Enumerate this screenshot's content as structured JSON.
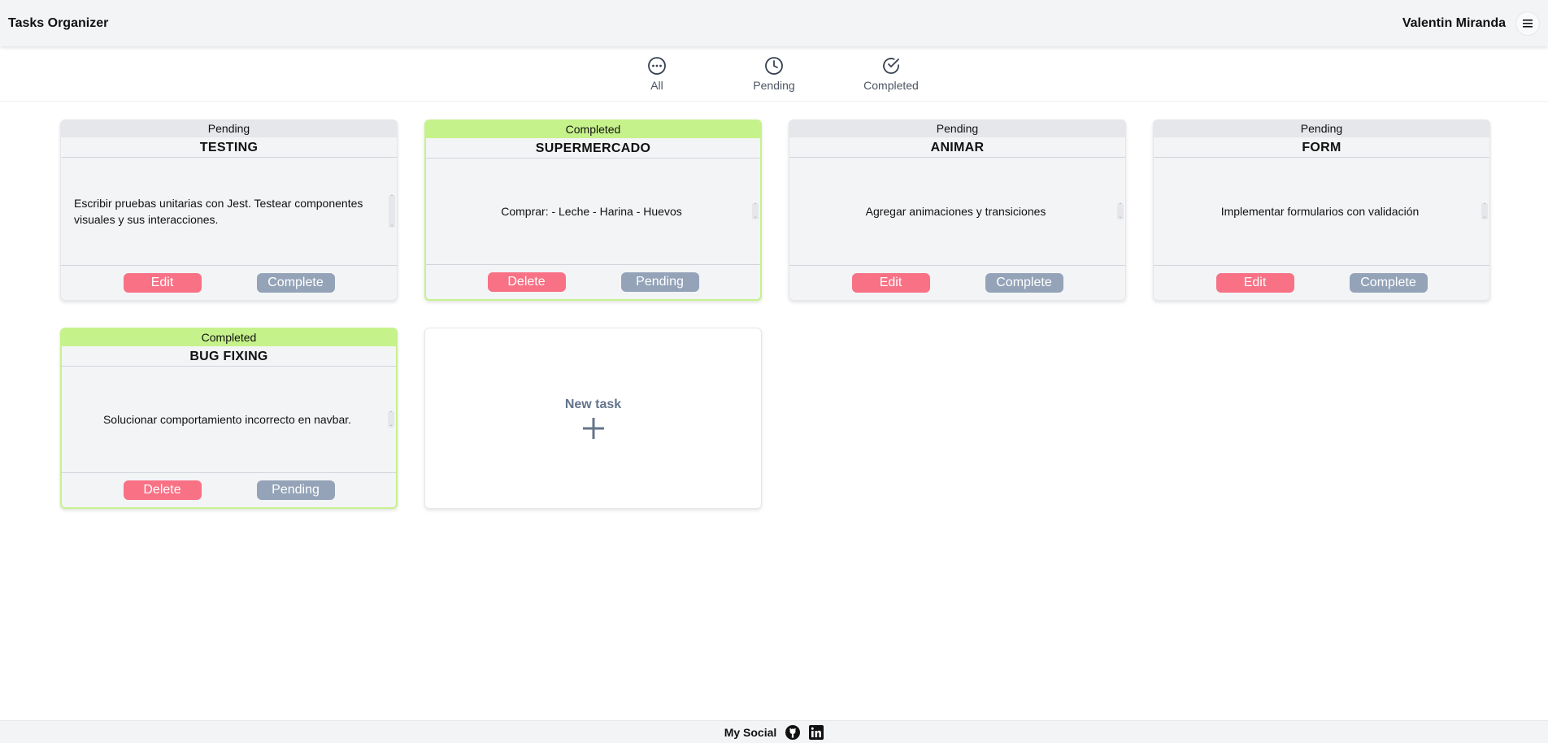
{
  "header": {
    "title": "Tasks Organizer",
    "user_name": "Valentin Miranda",
    "menu_icon": "hamburger-menu-icon"
  },
  "filters": [
    {
      "label": "All",
      "icon": "ellipsis-circle-icon"
    },
    {
      "label": "Pending",
      "icon": "clock-icon"
    },
    {
      "label": "Completed",
      "icon": "check-circle-icon"
    }
  ],
  "tasks": [
    {
      "status": "Pending",
      "title": "TESTING",
      "description": "Escribir pruebas unitarias con Jest. Testear componentes visuales y sus interacciones.",
      "primary_label": "Edit",
      "secondary_label": "Complete"
    },
    {
      "status": "Completed",
      "title": "SUPERMERCADO",
      "description": "Comprar: - Leche - Harina - Huevos",
      "primary_label": "Delete",
      "secondary_label": "Pending"
    },
    {
      "status": "Pending",
      "title": "ANIMAR",
      "description": "Agregar animaciones y transiciones",
      "primary_label": "Edit",
      "secondary_label": "Complete"
    },
    {
      "status": "Pending",
      "title": "FORM",
      "description": "Implementar formularios con validación",
      "primary_label": "Edit",
      "secondary_label": "Complete"
    },
    {
      "status": "Completed",
      "title": "BUG FIXING",
      "description": "Solucionar comportamiento incorrecto en navbar.",
      "primary_label": "Delete",
      "secondary_label": "Pending"
    }
  ],
  "new_task": {
    "label": "New task",
    "icon": "plus-icon"
  },
  "footer": {
    "label": "My Social",
    "icons": [
      "github-icon",
      "linkedin-icon"
    ]
  },
  "colors": {
    "completed_accent": "#c6f28b",
    "danger_button": "#f87185",
    "secondary_button": "#94a3b8"
  }
}
